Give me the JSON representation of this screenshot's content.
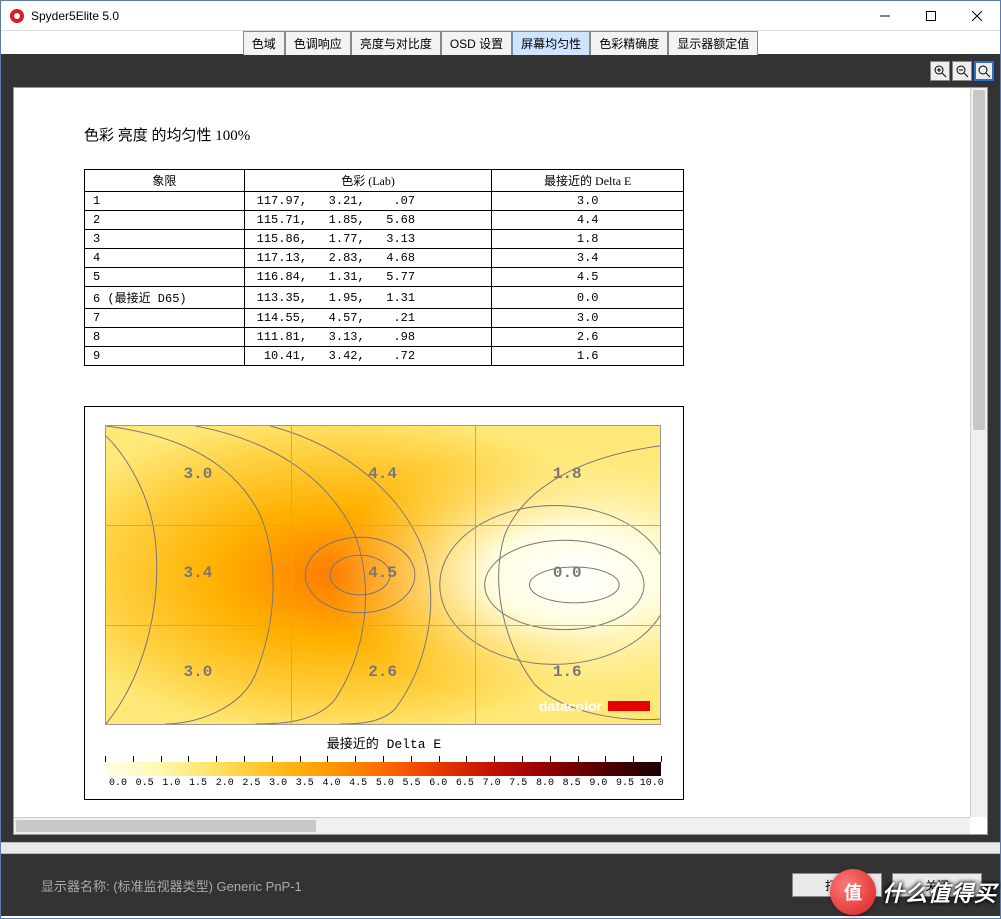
{
  "window": {
    "title": "Spyder5Elite 5.0"
  },
  "tabs": [
    {
      "label": "色域"
    },
    {
      "label": "色调响应"
    },
    {
      "label": "亮度与对比度"
    },
    {
      "label": "OSD 设置"
    },
    {
      "label": "屏幕均匀性",
      "active": true
    },
    {
      "label": "色彩精确度"
    },
    {
      "label": "显示器额定值"
    }
  ],
  "report": {
    "title": "色彩 亮度 的均匀性 100%",
    "columns": [
      "象限",
      "色彩 (Lab)",
      "最接近的 Delta E"
    ],
    "rows": [
      {
        "quadrant": "1",
        "lab": "117.97,   3.21,    .07",
        "deltaE": "3.0"
      },
      {
        "quadrant": "2",
        "lab": "115.71,   1.85,   5.68",
        "deltaE": "4.4"
      },
      {
        "quadrant": "3",
        "lab": "115.86,   1.77,   3.13",
        "deltaE": "1.8"
      },
      {
        "quadrant": "4",
        "lab": "117.13,   2.83,   4.68",
        "deltaE": "3.4"
      },
      {
        "quadrant": "5",
        "lab": "116.84,   1.31,   5.77",
        "deltaE": "4.5"
      },
      {
        "quadrant": "6 (最接近 D65)",
        "lab": "113.35,   1.95,   1.31",
        "deltaE": "0.0"
      },
      {
        "quadrant": "7",
        "lab": "114.55,   4.57,    .21",
        "deltaE": "3.0"
      },
      {
        "quadrant": "8",
        "lab": "111.81,   3.13,    .98",
        "deltaE": "2.6"
      },
      {
        "quadrant": "9",
        "lab": " 10.41,   3.42,    .72",
        "deltaE": "1.6"
      }
    ]
  },
  "heatmap": {
    "caption": "最接近的 Delta E",
    "logo": "datacolor",
    "grid_values": [
      [
        "3.0",
        "4.4",
        "1.8"
      ],
      [
        "3.4",
        "4.5",
        "0.0"
      ],
      [
        "3.0",
        "2.6",
        "1.6"
      ]
    ],
    "colorbar_ticks": [
      "0.0",
      "0.5",
      "1.0",
      "1.5",
      "2.0",
      "2.5",
      "3.0",
      "3.5",
      "4.0",
      "4.5",
      "5.0",
      "5.5",
      "6.0",
      "6.5",
      "7.0",
      "7.5",
      "8.0",
      "8.5",
      "9.0",
      "9.5",
      "10.0"
    ]
  },
  "chart_data": {
    "type": "heatmap",
    "title": "最接近的 Delta E",
    "xlabel": "",
    "ylabel": "",
    "grid": {
      "rows": 3,
      "cols": 3
    },
    "values": [
      [
        3.0,
        4.4,
        1.8
      ],
      [
        3.4,
        4.5,
        0.0
      ],
      [
        3.0,
        2.6,
        1.6
      ]
    ],
    "color_scale": {
      "min": 0.0,
      "max": 10.0,
      "step": 0.5
    },
    "annotations": [
      "datacolor"
    ]
  },
  "footer": {
    "monitor_label": "显示器名称:",
    "monitor_name": "(标准监视器类型) Generic PnP-1",
    "print": "打印",
    "close": "关闭"
  },
  "watermark": {
    "badge": "值",
    "text": "什么值得买"
  }
}
